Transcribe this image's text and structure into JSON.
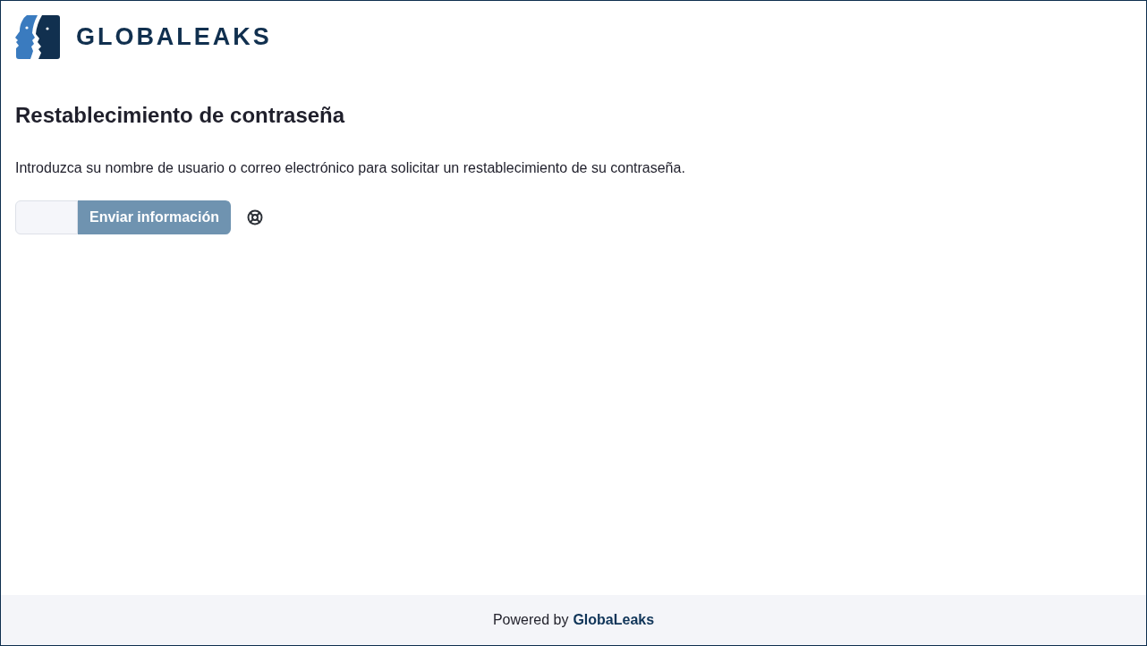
{
  "header": {
    "logo_text": "GLOBALEAKS"
  },
  "title": "Restablecimiento de contraseña",
  "description": "Introduzca su nombre de usuario o correo electrónico para solicitar un restablecimiento de su contraseña.",
  "form": {
    "submit_button": {
      "label": "Enviar información",
      "disabled": true
    }
  },
  "footer": {
    "prefix": "Powered by",
    "link": "GlobaLeaks"
  }
}
